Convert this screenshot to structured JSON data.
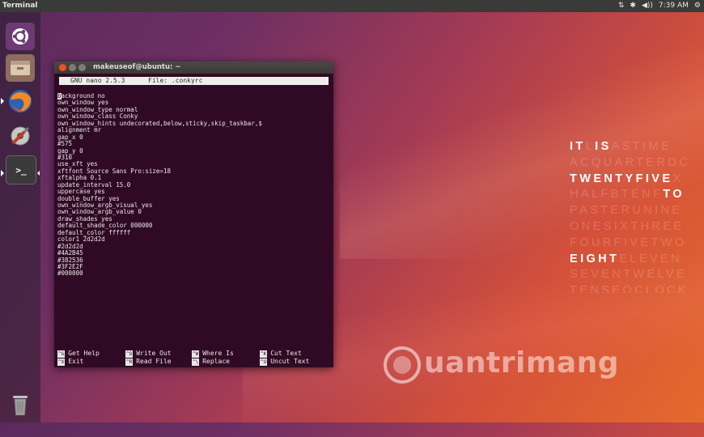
{
  "top_panel": {
    "app_title": "Terminal",
    "indicators": [
      "⇅",
      "✱",
      "◀))",
      "7:39 AM",
      "⚙"
    ]
  },
  "launcher": {
    "items": [
      {
        "name": "ubuntu-dash",
        "icon": "ubuntu-logo-icon"
      },
      {
        "name": "files",
        "icon": "files-icon"
      },
      {
        "name": "firefox",
        "icon": "firefox-icon"
      },
      {
        "name": "system-settings",
        "icon": "settings-icon"
      },
      {
        "name": "terminal",
        "icon": "terminal-icon",
        "glyph": ">_"
      },
      {
        "name": "trash",
        "icon": "trash-icon"
      }
    ]
  },
  "terminal": {
    "title": "makeuseof@ubuntu: ~",
    "nano_version": "GNU nano 2.5.3",
    "file": "File: .conkyrc",
    "lines": [
      "background no",
      "own_window yes",
      "own_window_type normal",
      "own_window_class Conky",
      "own_window_hints undecorated,below,sticky,skip_taskbar,$",
      "alignment mr",
      "gap_x 0",
      "#575",
      "gap_y 0",
      "#310",
      "use_xft yes",
      "xftfont Source Sans Pro:size=18",
      "xftalpha 0.1",
      "update_interval 15.0",
      "uppercase yes",
      "double_buffer yes",
      "own_window_argb_visual yes",
      "own_window_argb_value 0",
      "draw_shades yes",
      "default_shade_color 000000",
      "default_color ffffff",
      "color1 2d2d2d",
      "#2d2d2d",
      "#4A2B45",
      "#382536",
      "#3F2E2F",
      "#000000"
    ],
    "shortcuts": [
      {
        "key": "^G",
        "label": "Get Help"
      },
      {
        "key": "^O",
        "label": "Write Out"
      },
      {
        "key": "^W",
        "label": "Where Is"
      },
      {
        "key": "^K",
        "label": "Cut Text"
      },
      {
        "key": "^X",
        "label": "Exit"
      },
      {
        "key": "^R",
        "label": "Read File"
      },
      {
        "key": "^\\",
        "label": "Replace"
      },
      {
        "key": "^U",
        "label": "Uncut Text"
      }
    ]
  },
  "word_clock": {
    "rows": [
      [
        {
          "t": "IT",
          "lit": true
        },
        {
          "t": "L",
          "lit": false
        },
        {
          "t": "IS",
          "lit": true
        },
        {
          "t": "ASTIME",
          "lit": false
        }
      ],
      [
        {
          "t": "ACQUARTERDC",
          "lit": false
        }
      ],
      [
        {
          "t": "TWENTYFIVE",
          "lit": true
        },
        {
          "t": "X",
          "lit": false
        }
      ],
      [
        {
          "t": "HALFBTENF",
          "lit": false
        },
        {
          "t": "TO",
          "lit": true
        }
      ],
      [
        {
          "t": "PASTERUNINE",
          "lit": false
        }
      ],
      [
        {
          "t": "ONESIXTHREE",
          "lit": false
        }
      ],
      [
        {
          "t": "FOURFIVETWO",
          "lit": false
        }
      ],
      [
        {
          "t": "EIGHT",
          "lit": true
        },
        {
          "t": "ELEVEN",
          "lit": false
        }
      ],
      [
        {
          "t": "SEVENTWELVE",
          "lit": false
        }
      ],
      [
        {
          "t": "TENSEOCLOCK",
          "lit": false
        }
      ]
    ]
  },
  "watermark": {
    "text": "uantrimang"
  }
}
